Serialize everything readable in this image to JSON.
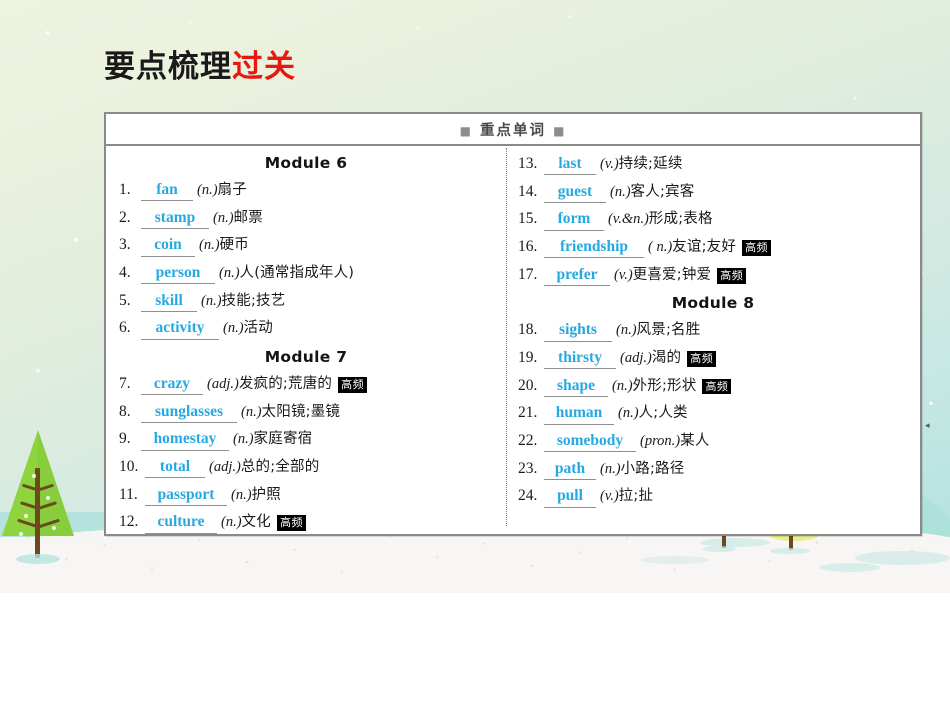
{
  "slide": {
    "title_black": "要点梳理",
    "title_red": "过关",
    "box_header": "重点单词",
    "header_square_left": "■",
    "header_square_right": "■",
    "badge_label": "高频"
  },
  "columns": {
    "left": [
      {
        "type": "module",
        "label": "Module 6"
      },
      {
        "type": "word",
        "num": "1.",
        "answer": "fan",
        "pos": "(n.)",
        "meaning": "扇子",
        "badge": ""
      },
      {
        "type": "word",
        "num": "2.",
        "answer": "stamp",
        "pos": "(n.)",
        "meaning": "邮票",
        "badge": ""
      },
      {
        "type": "word",
        "num": "3.",
        "answer": "coin",
        "pos": "(n.)",
        "meaning": "硬币",
        "badge": ""
      },
      {
        "type": "word",
        "num": "4.",
        "answer": "person",
        "pos": "(n.)",
        "meaning": "人(通常指成年人)",
        "badge": ""
      },
      {
        "type": "word",
        "num": "5.",
        "answer": "skill",
        "pos": "(n.)",
        "meaning": "技能;技艺",
        "badge": ""
      },
      {
        "type": "word",
        "num": "6.",
        "answer": "activity",
        "pos": "(n.)",
        "meaning": "活动",
        "badge": ""
      },
      {
        "type": "module",
        "label": "Module 7"
      },
      {
        "type": "word",
        "num": "7.",
        "answer": "crazy",
        "pos": "(adj.)",
        "meaning": "发疯的;荒唐的",
        "badge": "高频"
      },
      {
        "type": "word",
        "num": "8.",
        "answer": "sunglasses",
        "pos": "(n.)",
        "meaning": "太阳镜;墨镜",
        "badge": ""
      },
      {
        "type": "word",
        "num": "9.",
        "answer": "homestay",
        "pos": "(n.)",
        "meaning": "家庭寄宿",
        "badge": ""
      },
      {
        "type": "word",
        "num": "10.",
        "answer": "total",
        "pos": "(adj.)",
        "meaning": "总的;全部的",
        "badge": ""
      },
      {
        "type": "word",
        "num": "11.",
        "answer": "passport",
        "pos": "(n.)",
        "meaning": "护照",
        "badge": ""
      },
      {
        "type": "word",
        "num": "12.",
        "answer": "culture",
        "pos": "(n.)",
        "meaning": "文化",
        "badge": "高频"
      }
    ],
    "right": [
      {
        "type": "word",
        "num": "13.",
        "answer": "last",
        "pos": "(v.)",
        "meaning": "持续;延续",
        "badge": ""
      },
      {
        "type": "word",
        "num": "14.",
        "answer": "guest",
        "pos": "(n.)",
        "meaning": "客人;宾客",
        "badge": ""
      },
      {
        "type": "word",
        "num": "15.",
        "answer": "form",
        "pos": "(v.&n.)",
        "meaning": "形成;表格",
        "badge": ""
      },
      {
        "type": "word",
        "num": "16.",
        "answer": "friendship",
        "pos": "( n.)",
        "meaning": "友谊;友好",
        "badge": "高频"
      },
      {
        "type": "word",
        "num": "17.",
        "answer": "prefer",
        "pos": "(v.)",
        "meaning": "更喜爱;钟爱",
        "badge": "高频"
      },
      {
        "type": "module",
        "label": "Module 8"
      },
      {
        "type": "word",
        "num": "18.",
        "answer": "sights",
        "pos": "(n.)",
        "meaning": "风景;名胜",
        "badge": ""
      },
      {
        "type": "word",
        "num": "19.",
        "answer": "thirsty",
        "pos": "(adj.)",
        "meaning": "渴的",
        "badge": "高频"
      },
      {
        "type": "word",
        "num": "20.",
        "answer": "shape",
        "pos": "(n.)",
        "meaning": "外形;形状",
        "badge": "高频"
      },
      {
        "type": "word",
        "num": "21.",
        "answer": "human",
        "pos": "(n.)",
        "meaning": "人;人类",
        "badge": ""
      },
      {
        "type": "word",
        "num": "22.",
        "answer": "somebody",
        "pos": "(pron.)",
        "meaning": "某人",
        "badge": ""
      },
      {
        "type": "word",
        "num": "23.",
        "answer": "path",
        "pos": "(n.)",
        "meaning": "小路;路径",
        "badge": ""
      },
      {
        "type": "word",
        "num": "24.",
        "answer": "pull",
        "pos": "(v.)",
        "meaning": "拉;扯",
        "badge": ""
      }
    ]
  },
  "colors": {
    "answer_blue": "#26a9e0",
    "title_red": "#e8170f",
    "badge_bg": "#000000",
    "box_border": "#8a8a8a",
    "tree_green": "#8fd33f",
    "trunk_brown": "#6b4a20"
  }
}
